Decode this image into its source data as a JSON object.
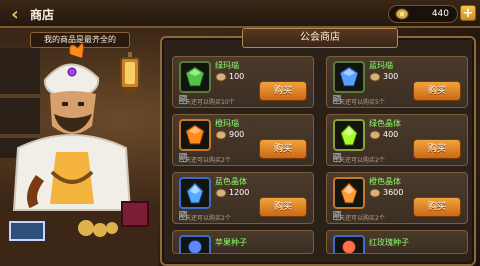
{
  "topbar": {
    "back_icon": "chevron-left-icon",
    "title": "商店",
    "currency": {
      "icon": "gold-coin-icon",
      "amount": "440"
    },
    "plus_label": "+"
  },
  "merchant": {
    "speech": "我的商品是最齐全的"
  },
  "shop": {
    "title": "公会商店",
    "items": [
      {
        "name": "绿玛瑙",
        "price": "100",
        "limit": "今天还可以购买10个",
        "buy": "购买",
        "color": "#56c24a",
        "frame": "green"
      },
      {
        "name": "蓝玛瑙",
        "price": "300",
        "limit": "今天还可以购买5个",
        "buy": "购买",
        "color": "#5aa0ff",
        "frame": "green"
      },
      {
        "name": "橙玛瑙",
        "price": "900",
        "limit": "今天还可以购买2个",
        "buy": "购买",
        "color": "#ff8a1c",
        "frame": "orange"
      },
      {
        "name": "绿色晶体",
        "price": "400",
        "limit": "今天还可以购买2个",
        "buy": "购买",
        "color": "#a7ff2a",
        "frame": "yellow"
      },
      {
        "name": "蓝色晶体",
        "price": "1200",
        "limit": "今天还可以购买2个",
        "buy": "购买",
        "color": "#57a8ff",
        "frame": "blue"
      },
      {
        "name": "橙色晶体",
        "price": "3600",
        "limit": "今天还可以购买2个",
        "buy": "购买",
        "color": "#ff9a3b",
        "frame": "orange"
      },
      {
        "name": "苹果种子",
        "price": "",
        "limit": "",
        "buy": "",
        "color": "#5d87ff",
        "frame": "blue"
      },
      {
        "name": "红玫瑰种子",
        "price": "",
        "limit": "",
        "buy": "",
        "color": "#ff6f4a",
        "frame": "blue"
      }
    ]
  },
  "colors": {
    "accent_gold": "#f2c254",
    "buy_button": "#e58a23",
    "item_name": "#8cff6a"
  }
}
